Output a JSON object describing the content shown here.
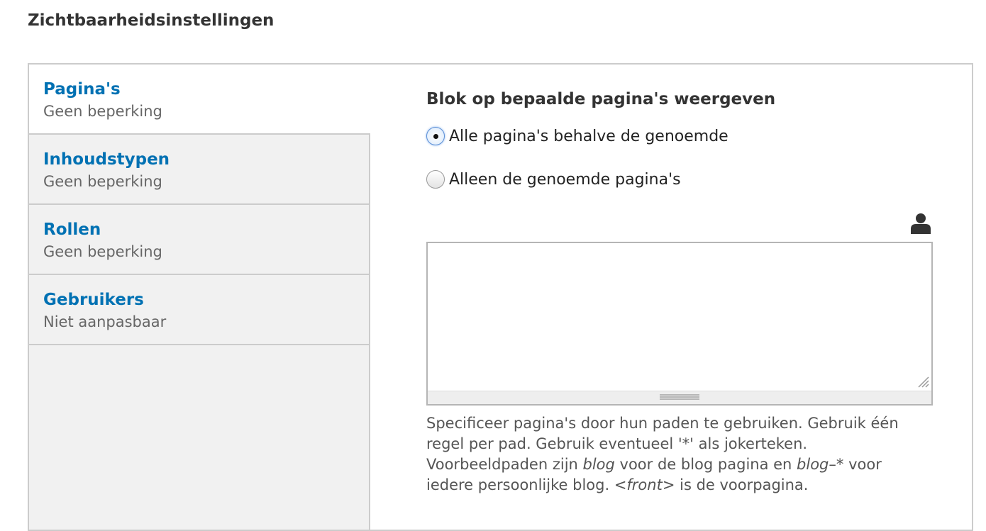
{
  "section_title": "Zichtbaarheidsinstellingen",
  "vertical_tabs": [
    {
      "title": "Pagina's",
      "summary": "Geen beperking",
      "selected": true
    },
    {
      "title": "Inhoudstypen",
      "summary": "Geen beperking",
      "selected": false
    },
    {
      "title": "Rollen",
      "summary": "Geen beperking",
      "selected": false
    },
    {
      "title": "Gebruikers",
      "summary": "Niet aanpasbaar",
      "selected": false
    }
  ],
  "pages_pane": {
    "heading": "Blok op bepaalde pagina's weergeven",
    "radio_options": [
      {
        "label": "Alle pagina's behalve de genoemde",
        "checked": true
      },
      {
        "label": "Alleen de genoemde pagina's",
        "checked": false
      }
    ],
    "pages_textarea_value": "",
    "description": {
      "part1": "Specificeer pagina's door hun paden te gebruiken. Gebruik één regel per pad. Gebruik eventueel '*' als jokerteken. Voorbeeldpaden zijn ",
      "example1": "blog",
      "part2": " voor de blog pagina en ",
      "example2": "blog",
      "part3": "–* voor iedere persoonlijke blog. ",
      "example3": "<front>",
      "part4": " is de voorpagina."
    }
  },
  "icons": {
    "user": "user-icon",
    "resize": "resize-handle-icon"
  },
  "colors": {
    "link_blue": "#0071b3",
    "tab_background": "#f1f1f1",
    "border": "#cccccc"
  }
}
